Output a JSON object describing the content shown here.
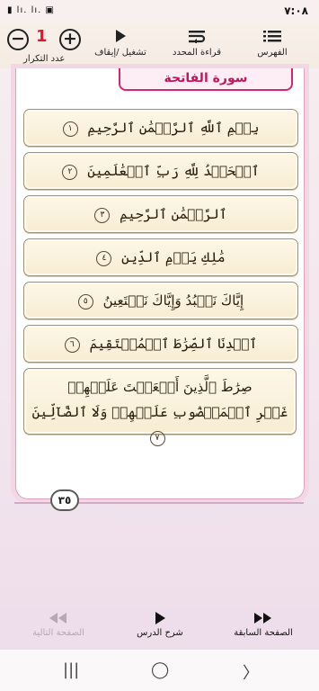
{
  "status": {
    "time": "٧:٠٨",
    "icons": "▮ lı. lı. ▣"
  },
  "toolbar": {
    "index_label": "الفهرس",
    "read_selected_label": "قراءة المحدد",
    "play_pause_label": "تشغيل /إيقاف",
    "repeat_count_label": "عدد التكرار",
    "repeat_count": "1",
    "icons": {
      "index": "list-icon",
      "read_selected": "wrap-icon",
      "play": "play-icon",
      "minus": "minus-circle-icon",
      "plus": "plus-circle-icon"
    }
  },
  "surah": {
    "title": "سورة الفاتحة",
    "page_number": "٣٥",
    "verses": [
      {
        "text": "بِسۡمِ ٱللَّهِ ٱلرَّحۡمَٰنِ ٱلرَّحِيمِ",
        "num": "١"
      },
      {
        "text": "ٱلۡحَمۡدُ لِلَّهِ رَبِّ ٱلۡعَٰلَمِينَ",
        "num": "٢"
      },
      {
        "text": "ٱلرَّحۡمَٰنِ ٱلرَّحِيمِ",
        "num": "٣"
      },
      {
        "text": "مَٰلِكِ يَوۡمِ ٱلدِّينِ",
        "num": "٤"
      },
      {
        "text": "إِيَّاكَ نَعۡبُدُ وَإِيَّاكَ نَسۡتَعِينُ",
        "num": "٥"
      },
      {
        "text": "ٱهۡدِنَا ٱلصِّرَٰطَ ٱلۡمُسۡتَقِيمَ",
        "num": "٦"
      },
      {
        "text": "صِرَٰطَ ٱلَّذِينَ أَنۡعَمۡتَ عَلَيۡهِمۡ",
        "text2": "غَيۡرِ ٱلۡمَغۡضُوبِ عَلَيۡهِمۡ وَلَا ٱلضَّآلِّينَ",
        "num": "٧"
      }
    ]
  },
  "bottom": {
    "next_page_label": "الصفحة التالية",
    "lesson_label": "شرح الدرس",
    "prev_page_label": "الصفحة السابقة",
    "colors": {
      "disabled": "#b8a8b4",
      "active": "#111111"
    }
  },
  "nav": {
    "recents": "|||",
    "home": "◯",
    "back": "〉"
  }
}
